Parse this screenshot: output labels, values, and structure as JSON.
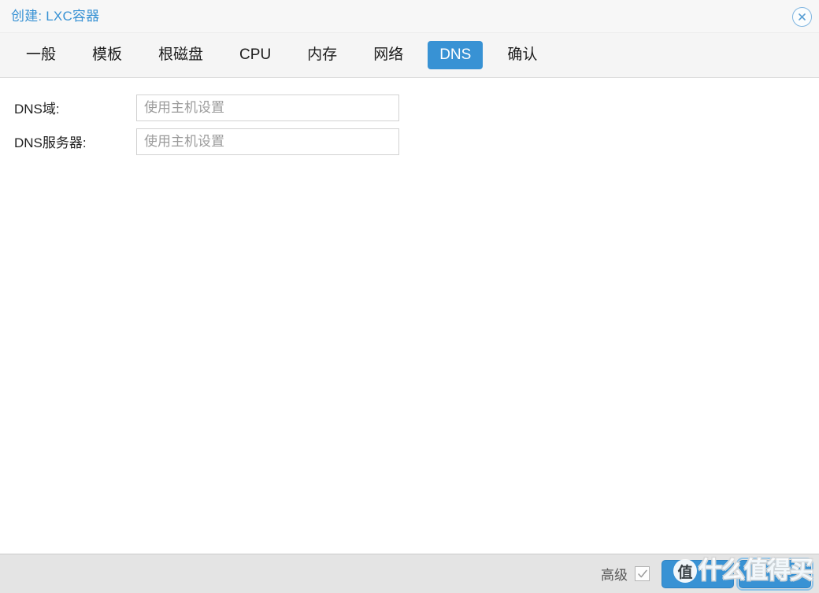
{
  "window": {
    "title": "创建: LXC容器",
    "close_icon": "close-circle-icon",
    "title_color": "#3892d4"
  },
  "tabs": {
    "active_index": 6,
    "items": [
      {
        "label": "一般"
      },
      {
        "label": "模板"
      },
      {
        "label": "根磁盘"
      },
      {
        "label": "CPU"
      },
      {
        "label": "内存"
      },
      {
        "label": "网络"
      },
      {
        "label": "DNS"
      },
      {
        "label": "确认"
      }
    ],
    "active_bg": "#3892d4",
    "active_fg": "#ffffff"
  },
  "form": {
    "fields": [
      {
        "label": "DNS域:",
        "value": "",
        "placeholder": "使用主机设置"
      },
      {
        "label": "DNS服务器:",
        "value": "",
        "placeholder": "使用主机设置"
      }
    ]
  },
  "footer": {
    "advanced_label": "高级",
    "advanced_checked": true,
    "check_icon": "checkmark-icon",
    "buttons": [
      {
        "label": ""
      },
      {
        "label": ""
      }
    ]
  },
  "watermark": {
    "badge": "值",
    "text": "什么值得买"
  }
}
